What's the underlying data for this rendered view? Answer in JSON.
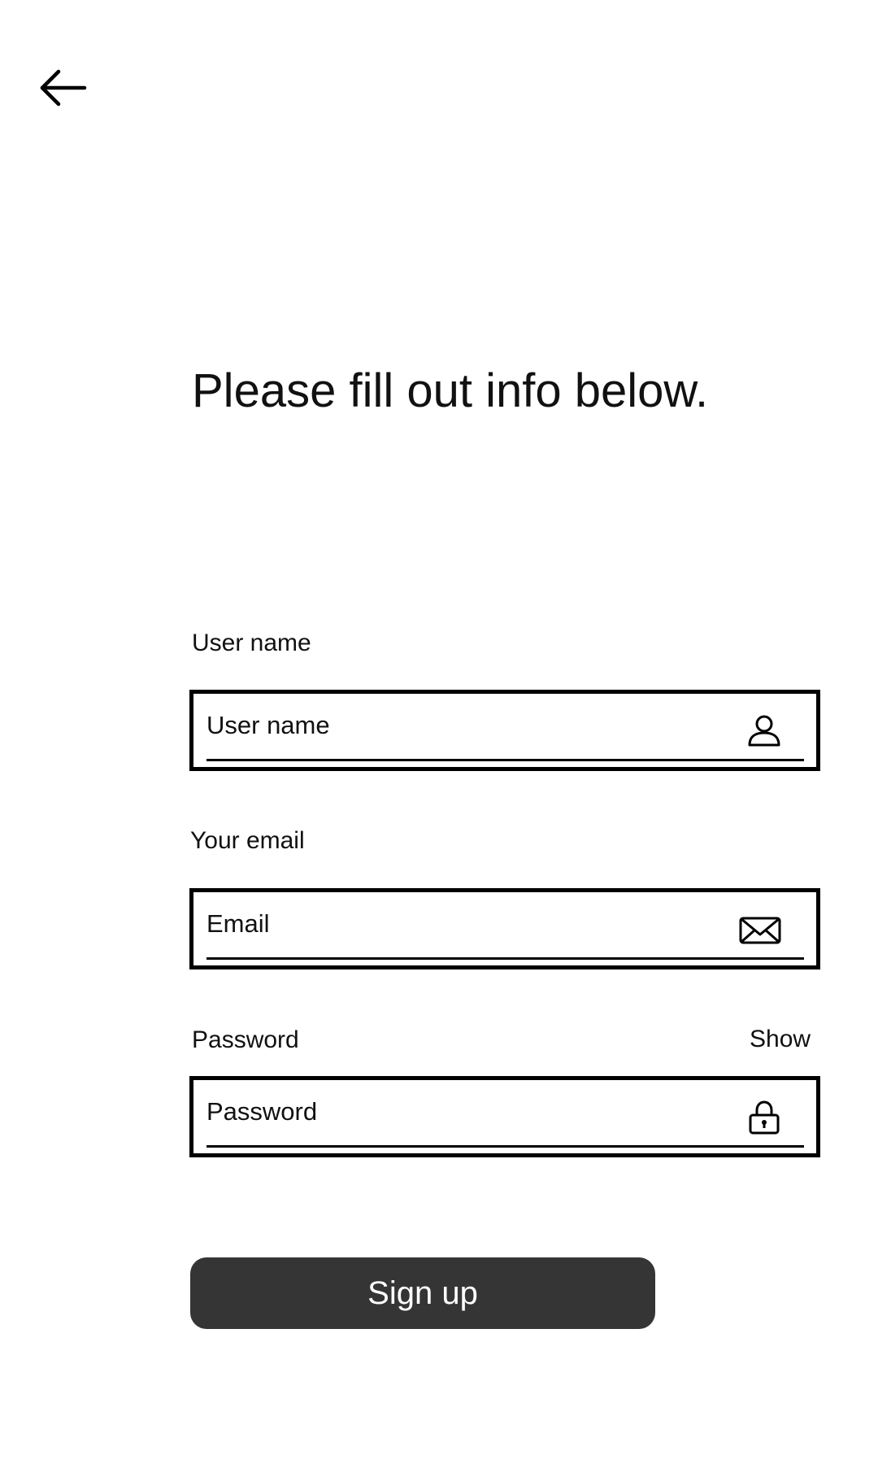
{
  "header": {
    "back_icon": "arrow-left-icon"
  },
  "title": "Please fill out info below.",
  "form": {
    "username": {
      "label": "User name",
      "placeholder": "User name",
      "icon": "user-icon"
    },
    "email": {
      "label": "Your email",
      "placeholder": "Email",
      "icon": "envelope-icon"
    },
    "password": {
      "label": "Password",
      "placeholder": "Password",
      "toggle_label": "Show",
      "icon": "lock-icon"
    },
    "submit_label": "Sign up"
  },
  "colors": {
    "button_background": "#353535",
    "button_text": "#ffffff",
    "border": "#000000",
    "text": "#111111",
    "background": "#ffffff"
  }
}
